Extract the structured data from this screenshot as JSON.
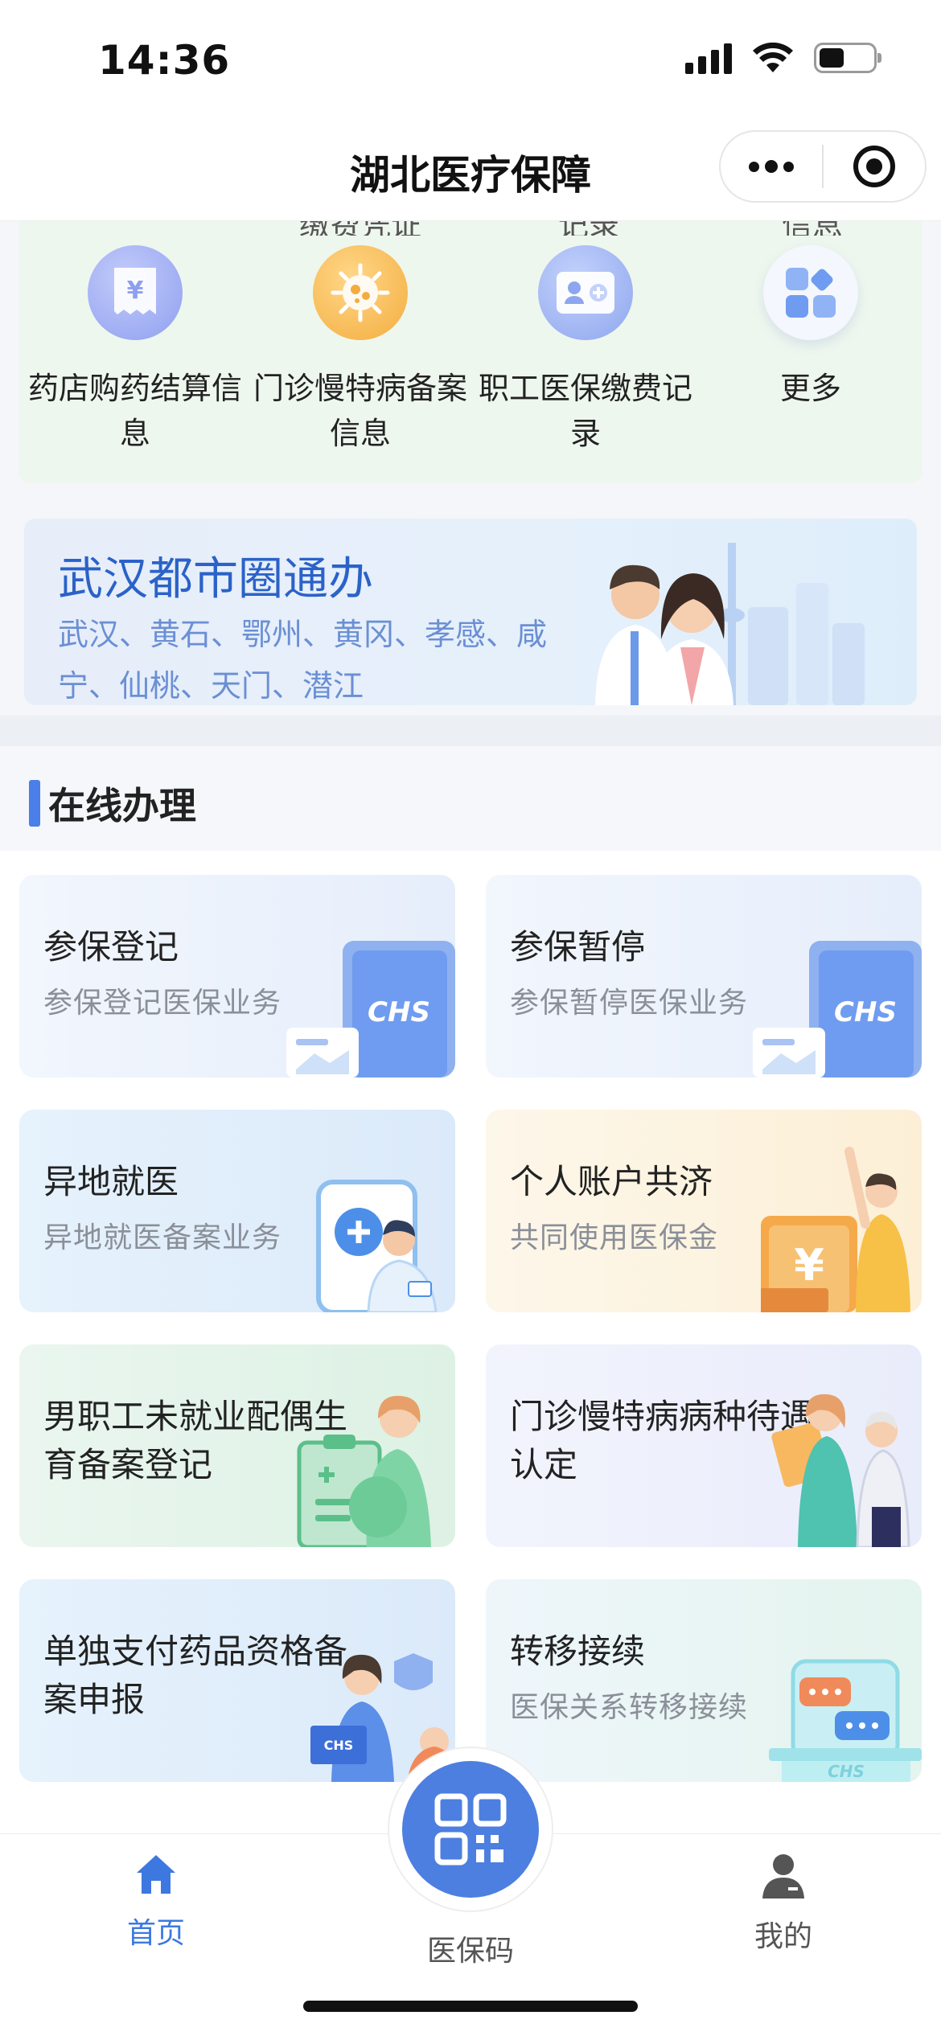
{
  "status_bar": {
    "time": "14:36"
  },
  "nav": {
    "title": "湖北医疗保障"
  },
  "quick_services": {
    "partial_labels": [
      "缴费凭证",
      "记录",
      "信息"
    ],
    "items": [
      {
        "label": "药店购药结算信息",
        "icon": "receipt-yen-icon",
        "color": "#8f9ff0"
      },
      {
        "label": "门诊慢特病备案信息",
        "icon": "virus-cell-icon",
        "color": "#f5b44a"
      },
      {
        "label": "职工医保缴费记录",
        "icon": "id-card-icon",
        "color": "#8ea6ef"
      },
      {
        "label": "更多",
        "icon": "grid-more-icon",
        "color": "#6f9cf0"
      }
    ]
  },
  "banner": {
    "title": "武汉都市圈通办",
    "cities": "武汉、黄石、鄂州、黄冈、孝感、咸宁、仙桃、天门、潜江"
  },
  "online": {
    "section_title": "在线办理",
    "cards": [
      {
        "title": "参保登记",
        "subtitle": "参保登记医保业务",
        "icon": "chs-card-icon"
      },
      {
        "title": "参保暂停",
        "subtitle": "参保暂停医保业务",
        "icon": "chs-card-icon"
      },
      {
        "title": "异地就医",
        "subtitle": "异地就医备案业务",
        "icon": "phone-doctor-icon"
      },
      {
        "title": "个人账户共济",
        "subtitle": "共同使用医保金",
        "icon": "wallet-family-icon"
      },
      {
        "title": "男职工未就业配偶生育备案登记",
        "subtitle": "",
        "icon": "pregnant-clipboard-icon"
      },
      {
        "title": "门诊慢特病病种待遇认定",
        "subtitle": "",
        "icon": "nurse-elderly-icon"
      },
      {
        "title": "单独支付药品资格备案申报",
        "subtitle": "",
        "icon": "doctor-computer-icon"
      },
      {
        "title": "转移接续",
        "subtitle": "医保关系转移接续",
        "icon": "chat-transfer-icon"
      }
    ]
  },
  "tabbar": {
    "home": "首页",
    "qr": "医保码",
    "mine": "我的",
    "active_color": "#3d78e0",
    "inactive_color": "#555555"
  }
}
